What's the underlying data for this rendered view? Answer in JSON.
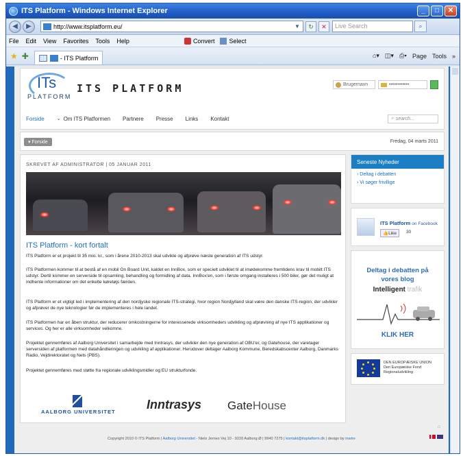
{
  "window": {
    "title": "ITS Platform - Windows Internet Explorer",
    "url": "http://www.itsplatform.eu/",
    "live_search_placeholder": "Live Search",
    "menu": [
      "File",
      "Edit",
      "View",
      "Favorites",
      "Tools",
      "Help"
    ],
    "convert_label": "Convert",
    "select_label": "Select",
    "tab_label": "- ITS Platform",
    "page_cmd": "Page",
    "tools_cmd": "Tools"
  },
  "site": {
    "logo_its": "ITs",
    "logo_platform": "PLATFORM",
    "logo_text": "ITS PLATFORM",
    "login_user_placeholder": "Brugernavn",
    "login_pass_value": "••••••••••••",
    "nav": [
      "Forside",
      "Om ITS Platformen",
      "Partnere",
      "Presse",
      "Links",
      "Kontakt"
    ],
    "search_placeholder": "search...",
    "breadcrumb_home": "Forside",
    "date": "Fredag, 04 marts 2011"
  },
  "article": {
    "meta": "SKREVET AF ADMINISTRATOR | 05 JANUAR 2011",
    "title": "ITS Platform - kort fortalt",
    "paragraphs": [
      "ITS Platform er et projekt til 35 mio. kr., som i årene 2010-2013 skal udvikle og afprøve næste generation af ITS udstyr.",
      "ITS Platformen kommer til at bestå af en mobil On Board Unit, kaldet en InnBox, som er specielt udviklet til at imødekomme fremtidens krav til mobilt ITS udstyr. Dertil kommer en serverside til opsamling, behandling og formidling af data. InnBox'en, som i første omgang installeres i 500 biler, gør det muligt at indhente informationer om det enkelte køretøjs færden.",
      "ITS Platform er et vigtigt led i implementering af den nordjyske regionale ITS-strategi, hvor region Nordjylland skal være den danske ITS-region, der udvikler og afprøver de nye teknologier før de implementeres i hele landet.",
      "ITS Platformen har en åben struktur, der reducerer omkostningerne for interesserede virksomheders udvikling og afprøvning af nye ITS applikationer og services. Og her er alle virksomheder velkomne.",
      "Projektet gennemføres af Aalborg Universitet i samarbejde med Inntrasys, der udvikler den nye generation af OBU'er, og Gatehouse, der varetager serversiden af platformen med datahåndteringen og udvikling af applikationer. Herudover deltager Aalborg Kommune, Beredskabscenter Aalborg, Danmarks Radio, Vejdirektoratet og Nets (PBS).",
      "Projektet gennemføres med støtte fra regionale udviklingsmidler og EU strukturfonde."
    ],
    "partner_au": "AALBORG UNIVERSITET",
    "partner_inntrasys": "Inntrasys",
    "partner_gate": "Gate",
    "partner_house": "House"
  },
  "sidebar": {
    "news_header": "Seneste Nyheder",
    "news_items": [
      "Deltag i debatten",
      "Vi søger frivillige"
    ],
    "fb_title": "ITS Platform",
    "fb_on": "on Facebook",
    "fb_like": "Like",
    "fb_count": "30",
    "debate_line1": "Deltag i debatten på",
    "debate_line2": "vores blog",
    "debate_intelligent": "Intelligent",
    "debate_trafik": "trafik",
    "debate_cta": "KLIK HER",
    "eu_line1": "DEN EUROPÆISKE UNION",
    "eu_line2": "Den Europæiske Fond",
    "eu_line3": "Regionaludvikling"
  },
  "footer": {
    "copyright": "Copyright 2010 © ITS Platform |",
    "au_link": "Aalborg Universitet",
    "address": "- Niels Jernes Vej 10 - 9220 Aalborg Ø | 9940 7275 |",
    "email": "kontakt@itsplatform.dk",
    "design": "| design by",
    "designer": "inwire"
  }
}
